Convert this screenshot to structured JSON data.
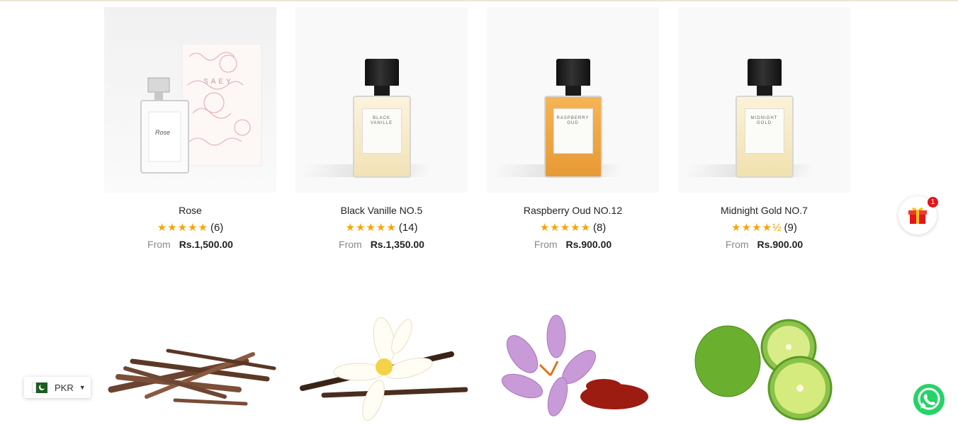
{
  "products": [
    {
      "name": "Rose",
      "stars": "★★★★★",
      "count": "(6)",
      "from": "From",
      "price": "Rs.1,500.00"
    },
    {
      "name": "Black Vanille NO.5",
      "stars": "★★★★★",
      "count": "(14)",
      "from": "From",
      "price": "Rs.1,350.00",
      "label": "BLACK VANILLE"
    },
    {
      "name": "Raspberry Oud NO.12",
      "stars": "★★★★★",
      "count": "(8)",
      "from": "From",
      "price": "Rs.900.00",
      "label": "RASPBERRY OUD"
    },
    {
      "name": "Midnight Gold NO.7",
      "stars": "★★★★½",
      "count": "(9)",
      "from": "From",
      "price": "Rs.900.00",
      "label": "MIDNIGHT GOLD"
    }
  ],
  "currency": {
    "code": "PKR"
  },
  "gift": {
    "badge": "1"
  },
  "colors": {
    "star": "#f6a40b",
    "badge": "#e3151b",
    "whatsapp": "#25d366",
    "gift": "#e3151b"
  }
}
